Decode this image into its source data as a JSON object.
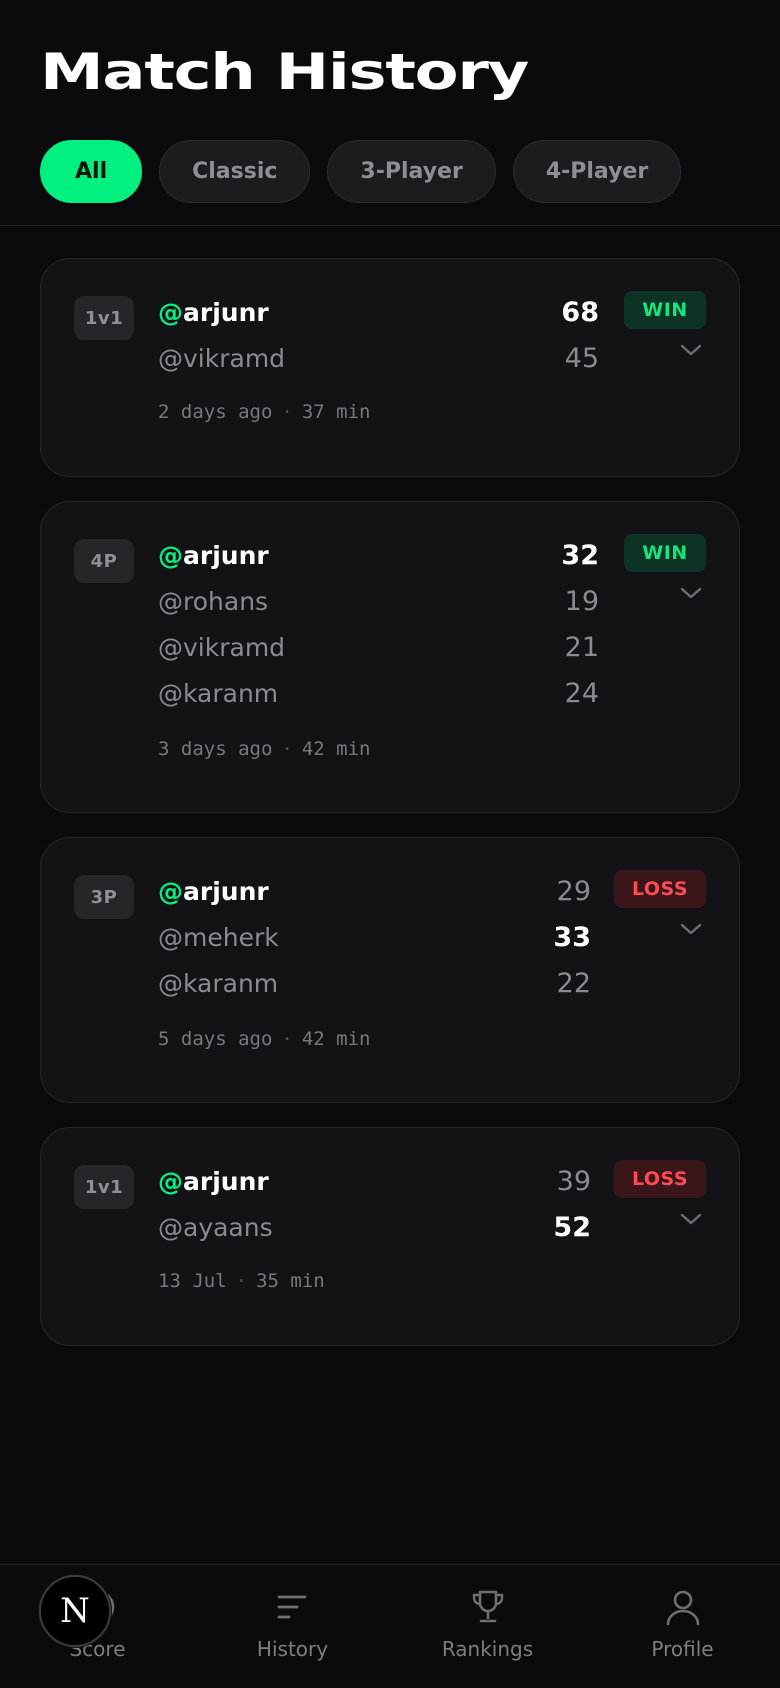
{
  "header": {
    "title": "Match History"
  },
  "filters": [
    {
      "label": "All",
      "active": true
    },
    {
      "label": "Classic",
      "active": false
    },
    {
      "label": "3-Player",
      "active": false
    },
    {
      "label": "4-Player",
      "active": false
    }
  ],
  "matches": [
    {
      "mode": "1v1",
      "result": "WIN",
      "players": [
        {
          "prefix": "@",
          "handle": "arjunr",
          "score": "68",
          "me": true,
          "top": true
        },
        {
          "prefix": "",
          "handle": "@vikramd",
          "score": "45",
          "me": false,
          "top": false
        }
      ],
      "when": "2 days ago",
      "duration": "37 min"
    },
    {
      "mode": "4P",
      "result": "WIN",
      "players": [
        {
          "prefix": "@",
          "handle": "arjunr",
          "score": "32",
          "me": true,
          "top": true
        },
        {
          "prefix": "",
          "handle": "@rohans",
          "score": "19",
          "me": false,
          "top": false
        },
        {
          "prefix": "",
          "handle": "@vikramd",
          "score": "21",
          "me": false,
          "top": false
        },
        {
          "prefix": "",
          "handle": "@karanm",
          "score": "24",
          "me": false,
          "top": false
        }
      ],
      "when": "3 days ago",
      "duration": "42 min"
    },
    {
      "mode": "3P",
      "result": "LOSS",
      "players": [
        {
          "prefix": "@",
          "handle": "arjunr",
          "score": "29",
          "me": true,
          "top": false
        },
        {
          "prefix": "",
          "handle": "@meherk",
          "score": "33",
          "me": false,
          "top": true
        },
        {
          "prefix": "",
          "handle": "@karanm",
          "score": "22",
          "me": false,
          "top": false
        }
      ],
      "when": "5 days ago",
      "duration": "42 min"
    },
    {
      "mode": "1v1",
      "result": "LOSS",
      "players": [
        {
          "prefix": "@",
          "handle": "arjunr",
          "score": "39",
          "me": true,
          "top": false
        },
        {
          "prefix": "",
          "handle": "@ayaans",
          "score": "52",
          "me": false,
          "top": true
        }
      ],
      "when": "13 Jul",
      "duration": "35 min"
    }
  ],
  "meta_separator": "·",
  "nav": [
    {
      "label": "Score",
      "icon": "score-icon"
    },
    {
      "label": "History",
      "icon": "history-icon"
    },
    {
      "label": "Rankings",
      "icon": "trophy-icon"
    },
    {
      "label": "Profile",
      "icon": "profile-icon"
    }
  ],
  "fab": {
    "label": "N"
  },
  "colors": {
    "accent": "#00f07f",
    "win": "#16e57d",
    "loss": "#ff4b54",
    "background": "#0b0b0e",
    "card": "#131317"
  }
}
